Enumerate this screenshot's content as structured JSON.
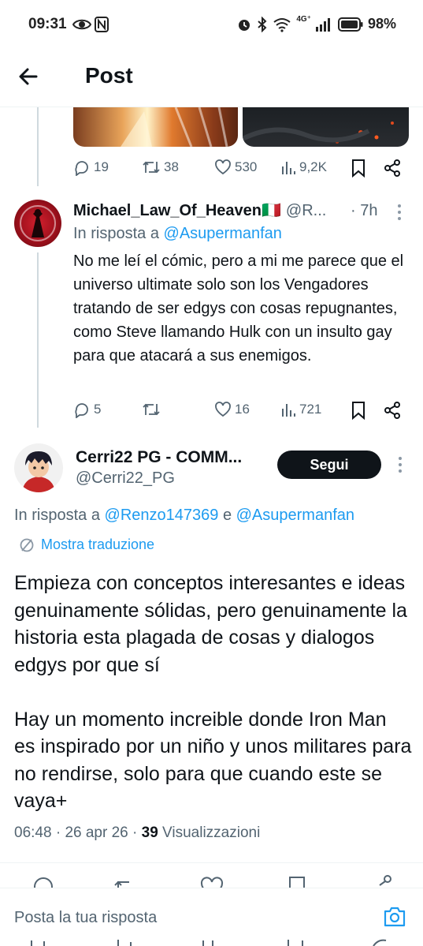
{
  "status_bar": {
    "time": "09:31",
    "network": "4G⁺",
    "battery": "98%"
  },
  "header": {
    "title": "Post"
  },
  "prev_post_actions": {
    "replies": "19",
    "reposts": "38",
    "likes": "530",
    "views": "9,2K"
  },
  "reply1": {
    "name": "Michael_Law_Of_Heaven🇮🇹",
    "handle": "@R...",
    "time": "· 7h",
    "replying_prefix": "In risposta a",
    "replying_to": "@Asupermanfan",
    "body": "No me leí el cómic, pero a mi me parece que el universo ultimate solo son los Vengadores tratando de ser edgys con cosas repugnantes, como Steve llamando Hulk con un insulto gay para que atacará a sus enemigos.",
    "replies": "5",
    "reposts": "",
    "likes": "16",
    "views": "721"
  },
  "main_post": {
    "name": "Cerri22 PG - COMM...",
    "handle": "@Cerri22_PG",
    "follow_label": "Segui",
    "replying_prefix": "In risposta a",
    "replying_to_1": "@Renzo147369",
    "replying_joiner": "e",
    "replying_to_2": "@Asupermanfan",
    "translate_label": "Mostra traduzione",
    "body_p1": "Empieza con conceptos interesantes e ideas genuinamente sólidas, pero genuinamente la historia esta plagada de cosas y dialogos edgys por que sí",
    "body_p2": "Hay un momento increible donde Iron Man es inspirado por un niño y unos militares para no rendirse, solo para que cuando este se vaya+",
    "time": "06:48",
    "date": "26 apr 26",
    "views_count": "39",
    "views_label": "Visualizzazioni"
  },
  "composer": {
    "placeholder": "Posta la tua risposta"
  },
  "colors": {
    "accent": "#1d9bf0",
    "text": "#0f1419",
    "secondary": "#536471",
    "line": "#cfd9de"
  }
}
